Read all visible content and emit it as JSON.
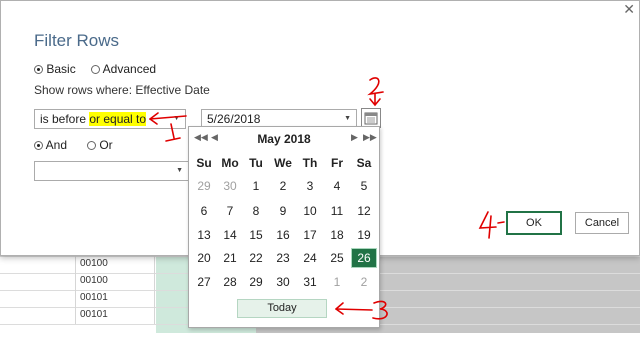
{
  "dialog": {
    "title": "Filter Rows",
    "close": "✕",
    "mode": {
      "basic": "Basic",
      "advanced": "Advanced",
      "selected": "Basic"
    },
    "show_rows_label": "Show rows where: Effective Date",
    "condition1": {
      "operator_prefix": "is before ",
      "operator_highlight": "or equal to",
      "value": "5/26/2018"
    },
    "logic": {
      "and": "And",
      "or": "Or",
      "selected": "And"
    },
    "condition2": {
      "operator": "",
      "value": ""
    },
    "ok_label": "OK",
    "cancel_label": "Cancel"
  },
  "calendar": {
    "month_label": "May 2018",
    "prev_year": "◀◀",
    "prev_month": "◀",
    "next_month": "▶",
    "next_year": "▶▶",
    "weekdays": [
      "Su",
      "Mo",
      "Tu",
      "We",
      "Th",
      "Fr",
      "Sa"
    ],
    "weeks": [
      [
        "29",
        "30",
        "1",
        "2",
        "3",
        "4",
        "5"
      ],
      [
        "6",
        "7",
        "8",
        "9",
        "10",
        "11",
        "12"
      ],
      [
        "13",
        "14",
        "15",
        "16",
        "17",
        "18",
        "19"
      ],
      [
        "20",
        "21",
        "22",
        "23",
        "24",
        "25",
        "26"
      ],
      [
        "27",
        "28",
        "29",
        "30",
        "31",
        "1",
        "2"
      ]
    ],
    "selected_day": "26",
    "today_label": "Today"
  },
  "background_cells": [
    "00100",
    "00100",
    "00101",
    "00101"
  ],
  "annotations": [
    "1",
    "2",
    "3",
    "4"
  ],
  "colors": {
    "accent": "#217346",
    "highlight": "#ffff00",
    "annotation": "#e00000",
    "title": "#4a6a8a"
  }
}
